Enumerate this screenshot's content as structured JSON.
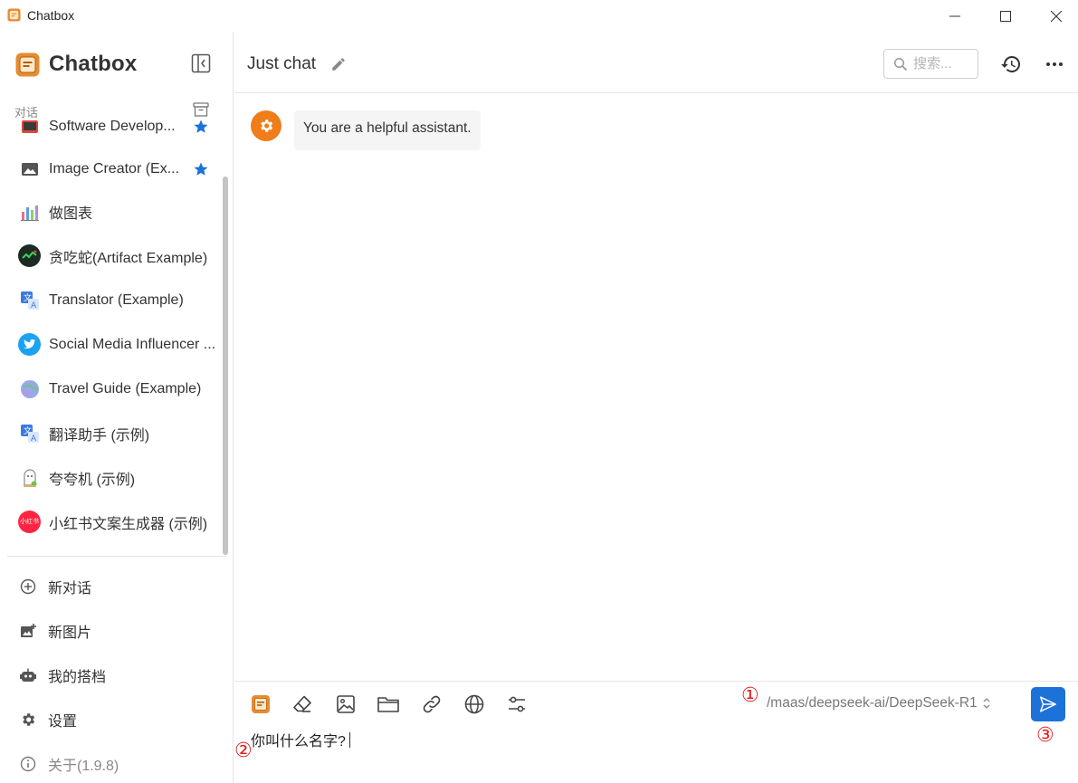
{
  "window": {
    "title": "Chatbox"
  },
  "sidebar": {
    "brand": "Chatbox",
    "section_label": "对话",
    "conversations": [
      {
        "label": "Software Develop...",
        "starred": true
      },
      {
        "label": "Image Creator (Ex...",
        "starred": true
      },
      {
        "label": "做图表",
        "starred": false
      },
      {
        "label": "贪吃蛇(Artifact Example)",
        "starred": false
      },
      {
        "label": "Translator (Example)",
        "starred": false
      },
      {
        "label": "Social Media Influencer ...",
        "starred": false
      },
      {
        "label": "Travel Guide (Example)",
        "starred": false
      },
      {
        "label": "翻译助手 (示例)",
        "starred": false
      },
      {
        "label": "夸夸机 (示例)",
        "starred": false
      },
      {
        "label": "小红书文案生成器 (示例)",
        "starred": false
      }
    ],
    "menu": {
      "new_chat": "新对话",
      "new_image": "新图片",
      "my_copilots": "我的搭档",
      "settings": "设置",
      "about": "关于(1.9.8)"
    },
    "xhs_avatar_text": "小红书",
    "colors": {
      "star": "#1c72d8"
    }
  },
  "header": {
    "title": "Just chat",
    "search_placeholder": "搜索..."
  },
  "messages": [
    {
      "role": "system",
      "text": "You are a helpful assistant."
    }
  ],
  "composer": {
    "model": "/maas/deepseek-ai/DeepSeek-R1",
    "input_value": "你叫什么名字?",
    "annotations": [
      "①",
      "②",
      "③"
    ],
    "colors": {
      "send": "#1c72d8",
      "annotation": "#e2201f"
    }
  }
}
